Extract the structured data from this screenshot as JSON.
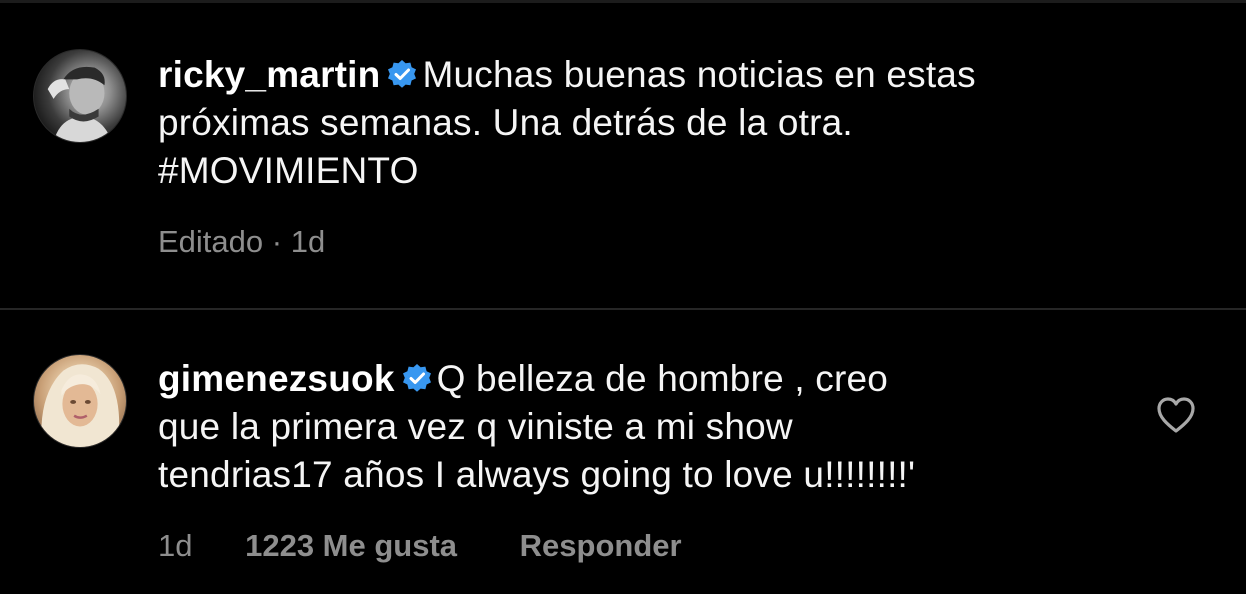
{
  "comments": [
    {
      "username": "ricky_martin",
      "text_lines": [
        "Muchas buenas noticias en estas",
        "próximas semanas. Una detrás de la otra.",
        "#MOVIMIENTO"
      ],
      "meta": {
        "edited": "Editado",
        "separator": "·",
        "time": "1d"
      }
    },
    {
      "username": "gimenezsuok",
      "text_lines": [
        "Q belleza de hombre , creo",
        "que la primera vez q viniste a mi show",
        "tendrias17 años I always going to love u!!!!!!!!'"
      ],
      "meta": {
        "time": "1d",
        "likes": "1223 Me gusta",
        "reply": "Responder"
      }
    }
  ],
  "icons": {
    "verified": "verified-badge-icon",
    "like": "heart-icon"
  },
  "colors": {
    "background": "#000000",
    "verified_blue": "#3897f0",
    "meta_gray": "#8e8e8e",
    "divider": "#262626"
  }
}
